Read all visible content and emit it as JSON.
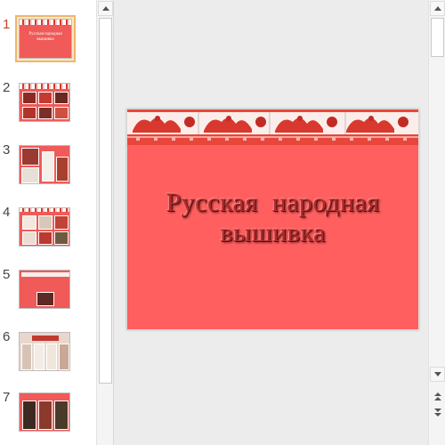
{
  "slides": [
    {
      "number": "1",
      "title": "Русская народная вышивка",
      "selected": true
    },
    {
      "number": "2",
      "selected": false
    },
    {
      "number": "3",
      "selected": false
    },
    {
      "number": "4",
      "selected": false
    },
    {
      "number": "5",
      "selected": false
    },
    {
      "number": "6",
      "selected": false
    },
    {
      "number": "7",
      "selected": false
    }
  ],
  "current_slide": {
    "title_line1": "Русская  народная",
    "title_line2": "вышивка"
  },
  "icons": {
    "scroll_up": "triangle-up-icon",
    "scroll_down": "triangle-down-icon",
    "prev_slide": "double-chevron-up-icon",
    "next_slide": "double-chevron-down-icon"
  },
  "colors": {
    "slide_background": "#ff5f5f",
    "title_text": "#b22b2b",
    "selected_number": "#c8442c",
    "selection_border": "#f0b66a"
  }
}
